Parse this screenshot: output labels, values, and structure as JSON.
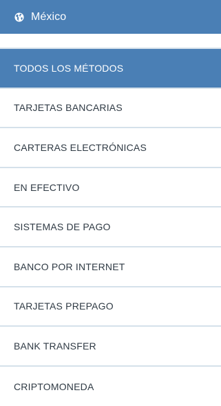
{
  "region": {
    "icon": "globe-icon",
    "label": "México"
  },
  "colors": {
    "accent": "#4a7fb5",
    "divider": "#d5e1ea",
    "text": "#2f3a44"
  },
  "menu": {
    "active_index": 0,
    "items": [
      {
        "label": "TODOS LOS MÉTODOS"
      },
      {
        "label": "TARJETAS BANCARIAS"
      },
      {
        "label": "CARTERAS ELECTRÓNICAS"
      },
      {
        "label": "EN EFECTIVO"
      },
      {
        "label": "SISTEMAS DE PAGO"
      },
      {
        "label": "BANCO POR INTERNET"
      },
      {
        "label": "TARJETAS PREPAGO"
      },
      {
        "label": "BANK TRANSFER"
      },
      {
        "label": "CRIPTOMONEDA"
      }
    ]
  }
}
